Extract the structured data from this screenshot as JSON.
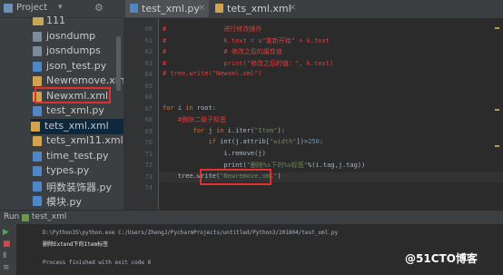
{
  "project_panel": {
    "title": "Project",
    "items": [
      {
        "label": "111",
        "kind": "folder"
      },
      {
        "label": "josndump",
        "kind": "file"
      },
      {
        "label": "josndumps",
        "kind": "file"
      },
      {
        "label": "json_test.py",
        "kind": "py"
      },
      {
        "label": "Newremove.xml",
        "kind": "xml"
      },
      {
        "label": "Newxml.xml",
        "kind": "xml",
        "highlighted": true
      },
      {
        "label": "test_xml.py",
        "kind": "py"
      },
      {
        "label": "tets_xml.xml",
        "kind": "xml",
        "selected": true
      },
      {
        "label": "tets_xml11.xml",
        "kind": "xml"
      },
      {
        "label": "time_test.py",
        "kind": "py"
      },
      {
        "label": "types.py",
        "kind": "py"
      },
      {
        "label": "明数装饰器.py",
        "kind": "py"
      },
      {
        "label": "模块.py",
        "kind": "py"
      },
      {
        "label": "1 py",
        "kind": "folder"
      }
    ]
  },
  "tabs": [
    {
      "label": "test_xml.py",
      "active": true
    },
    {
      "label": "tets_xml.xml",
      "active": false
    }
  ],
  "editor": {
    "line_numbers": [
      "60",
      "61",
      "62",
      "63",
      "64",
      "65",
      "66",
      "67",
      "68",
      "69",
      "70",
      "71",
      "72",
      "73",
      "74"
    ],
    "lines": [
      [
        {
          "c": "cm",
          "t": "#               进行修改操作"
        }
      ],
      [
        {
          "c": "cm",
          "t": "#               k.text = u\"重新开始\" + k.text"
        }
      ],
      [
        {
          "c": "cm",
          "t": "#               # 修改之后的属性值"
        }
      ],
      [
        {
          "c": "cm",
          "t": "#               print(\"修改之后的值：\", k.text)"
        }
      ],
      [
        {
          "c": "cm",
          "t": "# tree.write(\"Newxml.xml\")"
        }
      ],
      [],
      [],
      [
        {
          "c": "kw",
          "t": "for "
        },
        {
          "c": "vr",
          "t": "i "
        },
        {
          "c": "kw",
          "t": "in "
        },
        {
          "c": "vr",
          "t": "root:"
        }
      ],
      [
        {
          "c": "cm",
          "t": "    #删除二级子标签"
        }
      ],
      [
        {
          "c": "kw",
          "t": "        for "
        },
        {
          "c": "vr",
          "t": "j "
        },
        {
          "c": "kw",
          "t": "in "
        },
        {
          "c": "vr",
          "t": "i.iter("
        },
        {
          "c": "st",
          "t": "\"Item\""
        },
        {
          "c": "vr",
          "t": "):"
        }
      ],
      [
        {
          "c": "kw",
          "t": "            if "
        },
        {
          "c": "vr",
          "t": "int(j.attrib["
        },
        {
          "c": "st",
          "t": "\"width\""
        },
        {
          "c": "vr",
          "t": "])>"
        },
        {
          "c": "num",
          "t": "250"
        },
        {
          "c": "vr",
          "t": ":"
        }
      ],
      [
        {
          "c": "vr",
          "t": "                i.remove(j)"
        }
      ],
      [
        {
          "c": "vr",
          "t": "                print("
        },
        {
          "c": "st",
          "t": "\"删除%s下的%s标签\""
        },
        {
          "c": "vr",
          "t": "%(i.tag,j.tag))"
        }
      ],
      [
        {
          "c": "vr",
          "t": "    tree.write("
        },
        {
          "c": "st",
          "t": "\"Newremove.xml\""
        },
        {
          "c": "vr",
          "t": ")"
        }
      ],
      []
    ]
  },
  "run": {
    "label": "Run",
    "config_name": "test_xml",
    "console_lines": [
      {
        "text": "D:\\Python35\\python.exe C:/Users/ZhengJ/PycharmProjects/untitled/Python3/201804/test_xml.py",
        "color": "#a9b7c6"
      },
      {
        "text": "删除Extend下的Item标签",
        "color": "#e8e8e8"
      },
      {
        "text": "",
        "color": "#a9b7c6"
      },
      {
        "text": "Process finished with exit code 0",
        "color": "#a9b7c6"
      }
    ]
  },
  "watermark": "@51CTO博客"
}
